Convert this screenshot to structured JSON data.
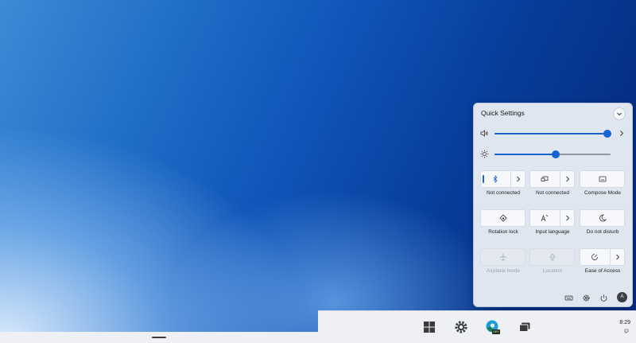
{
  "quick_settings": {
    "title": "Quick Settings",
    "volume_percent": 97,
    "brightness_percent": 53,
    "tiles": [
      {
        "id": "bluetooth",
        "label": "Not connected",
        "icon": "bluetooth-icon",
        "disabled": false,
        "split": true
      },
      {
        "id": "cast",
        "label": "Not connected",
        "icon": "cast-icon",
        "disabled": false,
        "split": true
      },
      {
        "id": "compose",
        "label": "Compose Mode",
        "icon": "compose-icon",
        "disabled": false,
        "split": false
      },
      {
        "id": "rotation",
        "label": "Rotation lock",
        "icon": "rotation-lock-icon",
        "disabled": false,
        "split": false
      },
      {
        "id": "input",
        "label": "Input language",
        "icon": "input-language-icon",
        "disabled": false,
        "split": true
      },
      {
        "id": "dnd",
        "label": "Do not disturb",
        "icon": "moon-icon",
        "disabled": false,
        "split": false
      },
      {
        "id": "airplane",
        "label": "Airplane mode",
        "icon": "airplane-icon",
        "disabled": true,
        "split": false
      },
      {
        "id": "location",
        "label": "Location",
        "icon": "location-icon",
        "disabled": true,
        "split": false
      },
      {
        "id": "ease",
        "label": "Ease of Access",
        "icon": "accessibility-icon",
        "disabled": false,
        "split": true
      }
    ],
    "avatar_initial": "A"
  },
  "taskbar": {
    "clock": "8:29",
    "edge_badge": "DEV"
  },
  "colors": {
    "accent": "#1464d2",
    "panel": "#dfe6f0",
    "taskbar": "#eef0f3"
  }
}
